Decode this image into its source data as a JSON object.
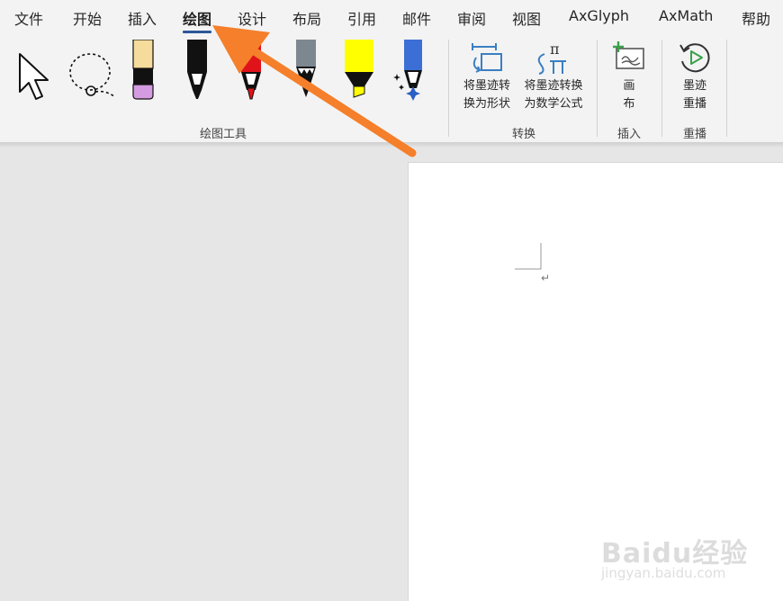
{
  "tabs": [
    {
      "label": "文件"
    },
    {
      "label": "开始"
    },
    {
      "label": "插入"
    },
    {
      "label": "绘图",
      "active": true
    },
    {
      "label": "设计"
    },
    {
      "label": "布局"
    },
    {
      "label": "引用"
    },
    {
      "label": "邮件"
    },
    {
      "label": "审阅"
    },
    {
      "label": "视图"
    },
    {
      "label": "AxGlyph"
    },
    {
      "label": "AxMath"
    },
    {
      "label": "帮助"
    }
  ],
  "ribbon": {
    "groups": {
      "drawing_tools": "绘图工具",
      "convert": "转换",
      "insert": "插入",
      "replay": "重播"
    },
    "buttons": {
      "ink_to_shape": "将墨迹转\n换为形状",
      "ink_to_math": "将墨迹转换\n为数学公式",
      "canvas": "画\n布",
      "ink_replay": "墨迹\n重播"
    },
    "tools": [
      "select-pointer",
      "lasso-select",
      "eraser",
      "pen-black",
      "pen-red",
      "pencil-gray",
      "highlighter-yellow",
      "galaxy-pen"
    ]
  },
  "document": {
    "paragraph_mark": "↵"
  },
  "watermark": {
    "logo": "Baidu经验",
    "url": "jingyan.baidu.com"
  },
  "colors": {
    "accent": "#2b579a",
    "arrow": "#f57f2a",
    "icon_blue": "#3a7fc1",
    "icon_green": "#3aa04a"
  }
}
